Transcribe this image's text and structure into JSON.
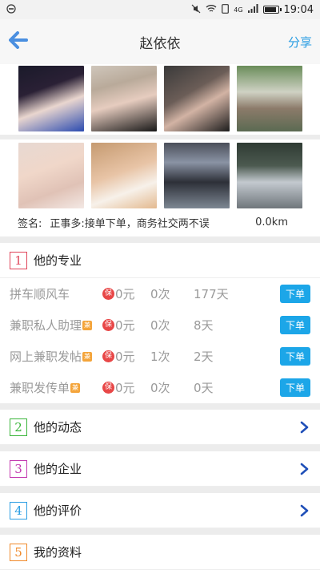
{
  "status": {
    "time": "19:04",
    "network": "4G"
  },
  "nav": {
    "title": "赵依依",
    "share": "分享"
  },
  "photos": [
    {
      "bg": "linear-gradient(160deg,#1a1a2a 0%,#2a2035 35%,#e9d6cf 60%,#2b4bb0 100%)"
    },
    {
      "bg": "linear-gradient(165deg,#cfc6bb 0%,#b9aa9a 30%,#e6ccbf 55%,#181818 100%)"
    },
    {
      "bg": "linear-gradient(150deg,#3a3a3a 0%,#6b5d57 40%,#d2b3a4 60%,#1d1d1d 100%)"
    },
    {
      "bg": "linear-gradient(180deg,#6a8d5a 0%,#cfd2c4 40%,#8c7b6a 65%,#5b6a52 100%)"
    },
    {
      "bg": "linear-gradient(160deg,#e7d8d2 0%,#f0d7c9 40%,#e0c2b6 70%,#f3e8e4 100%)"
    },
    {
      "bg": "linear-gradient(160deg,#c59a70 0%,#e8c4a6 45%,#f7f1ea 70%,#e3b98f 100%)"
    },
    {
      "bg": "linear-gradient(180deg,#4b4f5a 0%,#8a93a4 30%,#2d3038 60%,#7d8793 100%)"
    },
    {
      "bg": "linear-gradient(180deg,#2f3b33 0%,#4c5a50 35%,#c3c9cf 60%,#6f767b 100%)"
    }
  ],
  "profile": {
    "sig_label": "签名:",
    "signature": "正事多:接单下单，商务社交两不误",
    "distance": "0.0km"
  },
  "sections": {
    "s1": {
      "num": "1",
      "title": "他的专业",
      "color": "#e0455a"
    },
    "s2": {
      "num": "2",
      "title": "他的动态",
      "color": "#3ab53a"
    },
    "s3": {
      "num": "3",
      "title": "他的企业",
      "color": "#c33ab0"
    },
    "s4": {
      "num": "4",
      "title": "他的评价",
      "color": "#2a9de3"
    },
    "s5": {
      "num": "5",
      "title": "我的资料",
      "color": "#f08a2b"
    }
  },
  "services": [
    {
      "name": "拼车顺风车",
      "part": "",
      "bao": "保",
      "price": "0元",
      "count": "0次",
      "days": "177天",
      "btn": "下单"
    },
    {
      "name": "兼职私人助理",
      "part": "兼",
      "bao": "保",
      "price": "0元",
      "count": "0次",
      "days": "8天",
      "btn": "下单"
    },
    {
      "name": "网上兼职发帖",
      "part": "兼",
      "bao": "保",
      "price": "0元",
      "count": "1次",
      "days": "2天",
      "btn": "下单"
    },
    {
      "name": "兼职发传单",
      "part": "兼",
      "bao": "保",
      "price": "0元",
      "count": "0次",
      "days": "0天",
      "btn": "下单"
    }
  ],
  "colors": {
    "accent": "#1ca6e8",
    "share": "#2a9de3",
    "chevron": "#1f4fb8"
  },
  "icons": {
    "back": "arrow-left-icon",
    "chevron": "chevron-right-icon"
  }
}
